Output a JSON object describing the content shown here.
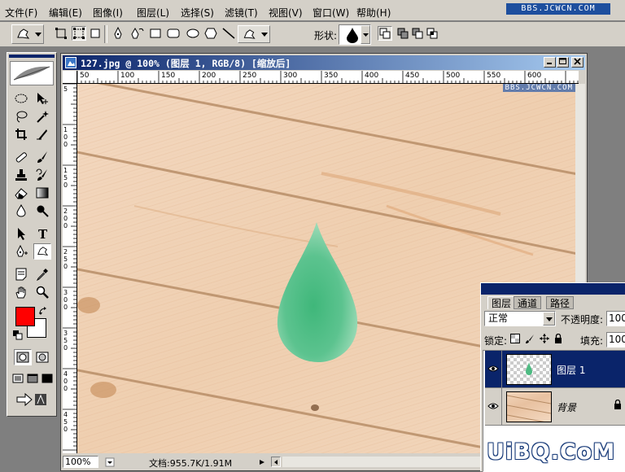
{
  "menu": {
    "items": [
      "文件(F)",
      "编辑(E)",
      "图像(I)",
      "图层(L)",
      "选择(S)",
      "滤镜(T)",
      "视图(V)",
      "窗口(W)",
      "帮助(H)"
    ],
    "watermark": "BBS.JCWCN.COM"
  },
  "options_bar": {
    "shape_label": "形状:"
  },
  "document": {
    "title": "127.jpg @ 100% (图层 1, RGB/8) [缩放后]",
    "canvas_watermark": "BBS.JCWCN.COM",
    "ruler_h": [
      "50",
      "100",
      "150",
      "200",
      "250",
      "300",
      "350",
      "400",
      "450",
      "500",
      "550",
      "600"
    ],
    "ruler_v": [
      "5",
      "1 0 0",
      "1 5 0",
      "2 0 0",
      "2 5 0",
      "3 0 0",
      "3 5 0",
      "4 0 0",
      "4 5 0"
    ],
    "zoom": "100%",
    "doc_size": "文档:955.7K/1.91M"
  },
  "colors": {
    "foreground": "#ff0000",
    "background": "#ffffff",
    "titlebar_start": "#0a246a",
    "titlebar_end": "#a6caf0",
    "drop": "#4dbb82"
  },
  "layers_panel": {
    "tabs": [
      "图层",
      "通道",
      "路径"
    ],
    "blend_mode": "正常",
    "opacity_label": "不透明度:",
    "opacity_value": "100",
    "lock_label": "锁定:",
    "fill_label": "填充:",
    "fill_value": "100",
    "layers": [
      {
        "name": "图层 1",
        "selected": true
      },
      {
        "name": "背景",
        "selected": false
      }
    ]
  },
  "site_watermark": "UiBQ.CoM"
}
